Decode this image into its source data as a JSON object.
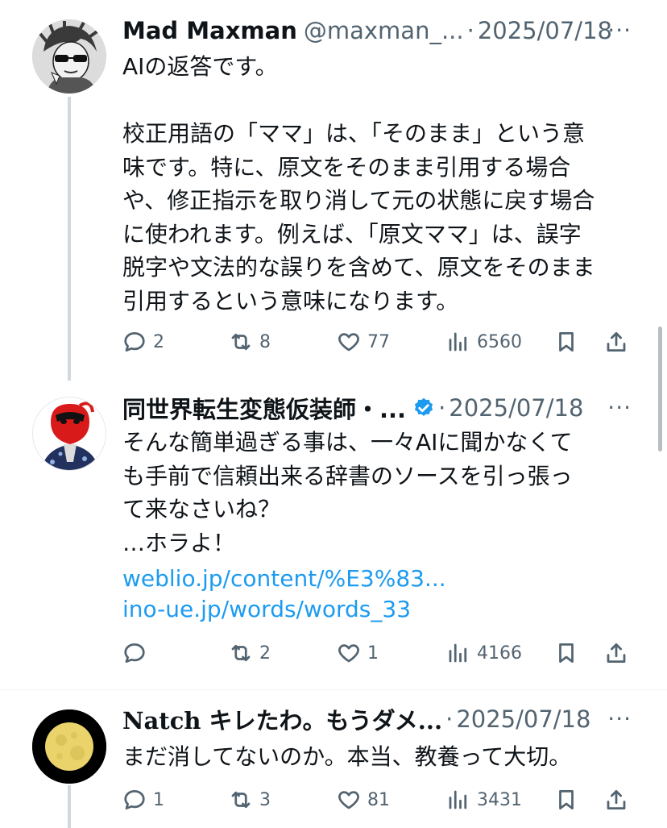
{
  "tweets": [
    {
      "name": "Mad Maxman",
      "handle": "@maxman_...",
      "dot": "·",
      "date": "2025/07/18",
      "more": "···",
      "text": "AIの返答です。\n\n校正用語の「ママ」は、「そのまま」という意\n味です。特に、原文をそのまま引用する場合\nや、修正指示を取り消して元の状態に戻す場合\nに使われます。例えば、「原文ママ」は、誤字\n脱字や文法的な誤りを含めて、原文をそのまま\n引用するという意味になります。",
      "replies": "2",
      "retweets": "8",
      "likes": "77",
      "views": "6560"
    },
    {
      "name": "同世界転生変態仮装師・...",
      "dot": "·",
      "date": "2025/07/18",
      "more": "···",
      "text": "そんな簡単過ぎる事は、一々AIに聞かなくて\nも手前で信頼出来る辞書のソースを引っ張っ\nて来なさいね？\n…ホラよ！",
      "links": [
        "weblio.jp/content/%E3%83...",
        "ino-ue.jp/words/words_33"
      ],
      "replies": "",
      "retweets": "2",
      "likes": "1",
      "views": "4166"
    },
    {
      "name": "Natch キレたわ。もうダメ...",
      "dot": "·",
      "date": "2025/07/18",
      "more": "···",
      "text": "まだ消してないのか。本当、教養って大切。",
      "replies": "1",
      "retweets": "3",
      "likes": "81",
      "views": "3431"
    }
  ],
  "colors": {
    "text": "#0f1419",
    "secondary": "#536471",
    "link": "#1d9bf0",
    "verified": "#1d9bf0",
    "thread_line": "#cfd9de"
  }
}
